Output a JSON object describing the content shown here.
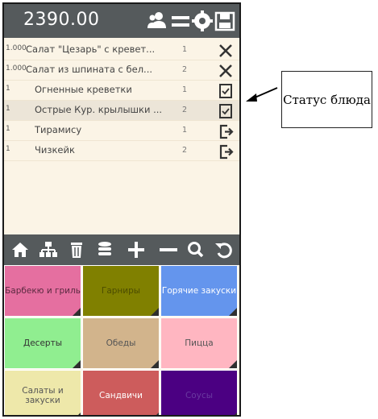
{
  "header": {
    "total": "2390.00",
    "icons": [
      "users-icon",
      "menu-icon",
      "settings-icon",
      "save-icon"
    ]
  },
  "orders": [
    {
      "qty": "1.000",
      "name": "Салат \"Цезарь\" с кревет...",
      "course": "1",
      "status": "close-icon"
    },
    {
      "qty": "1.000",
      "name": "Салат из шпината с бел...",
      "course": "2",
      "status": "close-icon"
    },
    {
      "qty": "1",
      "name": "Огненные креветки",
      "course": "1",
      "status": "checkbox-icon"
    },
    {
      "qty": "1",
      "name": "Острые Кур. крылышки ...",
      "course": "2",
      "status": "checkbox-icon"
    },
    {
      "qty": "1",
      "name": "Тирамису",
      "course": "1",
      "status": "exit-icon"
    },
    {
      "qty": "1",
      "name": "Чизкейк",
      "course": "2",
      "status": "exit-icon"
    }
  ],
  "toolbar": {
    "icons": [
      "home-icon",
      "network-icon",
      "trash-icon",
      "database-icon",
      "plus-icon",
      "minus-icon",
      "search-icon",
      "undo-icon"
    ]
  },
  "categories": [
    {
      "label": "Барбекю и гриль",
      "bg": "#e56fa0",
      "fg": "#5a2a40"
    },
    {
      "label": "Гарниры",
      "bg": "#808000",
      "fg": "#4c4c00"
    },
    {
      "label": "Горячие закуски",
      "bg": "#6495ed",
      "fg": "#ffffff"
    },
    {
      "label": "Десерты",
      "bg": "#90ee90",
      "fg": "#333333"
    },
    {
      "label": "Обеды",
      "bg": "#d2b48c",
      "fg": "#555555"
    },
    {
      "label": "Пицца",
      "bg": "#ffb6c1",
      "fg": "#555555"
    },
    {
      "label": "Салаты и закуски",
      "bg": "#eee8aa",
      "fg": "#555555"
    },
    {
      "label": "Сандвичи",
      "bg": "#cd5c5c",
      "fg": "#ffffff"
    },
    {
      "label": "Соусы",
      "bg": "#4b0082",
      "fg": "#6a3aa0"
    }
  ],
  "annotation": {
    "text": "Статус блюда"
  },
  "colors": {
    "bar": "#555a5c",
    "list_bg": "#fbf4e6"
  }
}
